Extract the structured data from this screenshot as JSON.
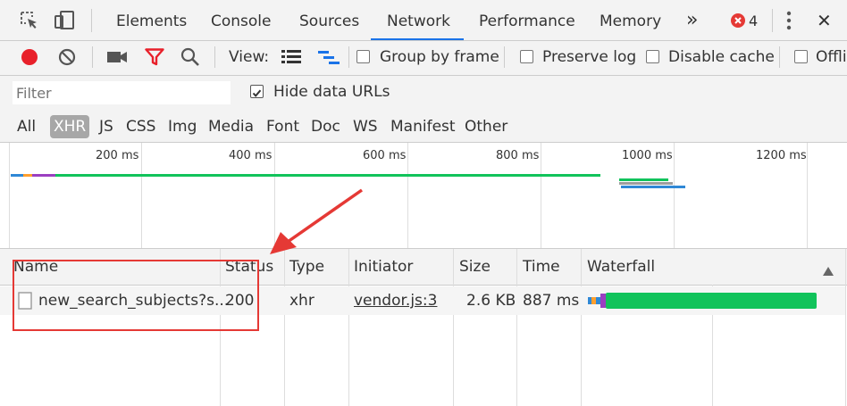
{
  "tabs": {
    "items": [
      "Elements",
      "Console",
      "Sources",
      "Network",
      "Performance",
      "Memory"
    ],
    "more": "»",
    "error_count": "4",
    "close": "✕"
  },
  "toolbar": {
    "view_label": "View:",
    "group_by_frame": "Group by frame",
    "preserve_log": "Preserve log",
    "disable_cache": "Disable cache",
    "offline": "Offli"
  },
  "filter": {
    "placeholder": "Filter",
    "hide_data_urls": "Hide data URLs"
  },
  "types": [
    "All",
    "XHR",
    "JS",
    "CSS",
    "Img",
    "Media",
    "Font",
    "Doc",
    "WS",
    "Manifest",
    "Other"
  ],
  "overview": {
    "ticks": [
      "200 ms",
      "400 ms",
      "600 ms",
      "800 ms",
      "1000 ms",
      "1200 ms"
    ]
  },
  "table": {
    "headers": {
      "name": "Name",
      "status": "Status",
      "type": "Type",
      "initiator": "Initiator",
      "size": "Size",
      "time": "Time",
      "waterfall": "Waterfall"
    },
    "rows": [
      {
        "name": "new_search_subjects?s...",
        "status": "200",
        "type": "xhr",
        "initiator": "vendor.js:3",
        "size": "2.6 KB",
        "time": "887 ms"
      }
    ]
  },
  "colors": {
    "record": "#e8202a",
    "filter_active": "#e8202a",
    "tab_underline": "#1a73e8",
    "waterfall_receive": "#11c35b",
    "annotation": "#e53935"
  }
}
